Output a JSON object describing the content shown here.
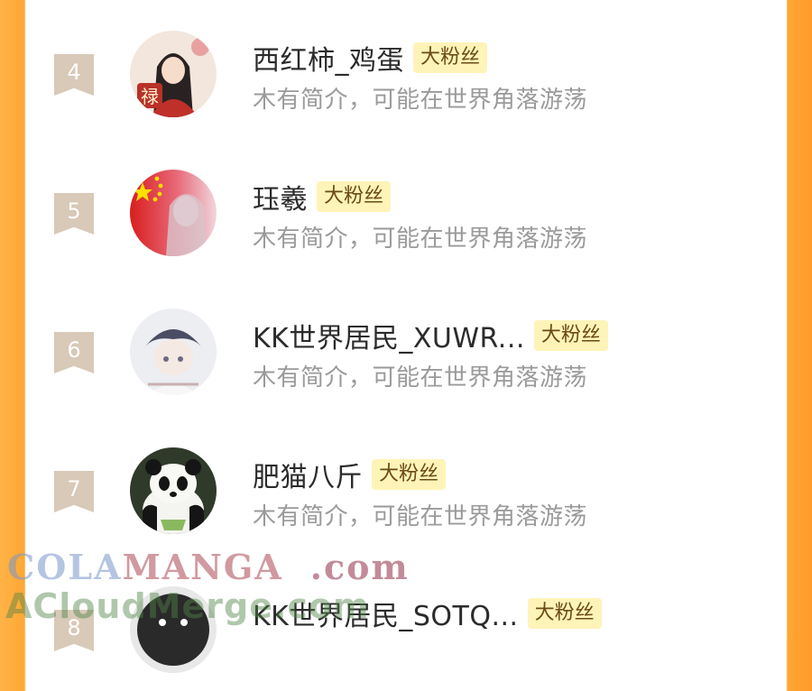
{
  "list": {
    "badge_text": "大粉丝",
    "rows": [
      {
        "rank": "4",
        "name": "西红柿_鸡蛋",
        "badge": "大粉丝",
        "desc": "木有简介，可能在世界角落游荡"
      },
      {
        "rank": "5",
        "name": "珏羲",
        "badge": "大粉丝",
        "desc": "木有简介，可能在世界角落游荡"
      },
      {
        "rank": "6",
        "name": "KK世界居民_XUWR...",
        "badge": "大粉丝",
        "desc": "木有简介，可能在世界角落游荡"
      },
      {
        "rank": "7",
        "name": "肥猫八斤",
        "badge": "大粉丝",
        "desc": "木有简介，可能在世界角落游荡"
      },
      {
        "rank": "8",
        "name": "KK世界居民_SOTQ...",
        "badge": "大粉丝",
        "desc": ""
      }
    ]
  },
  "watermark": {
    "line1_a": "COLA",
    "line1_b": "MANGA",
    "line1_c": ".com",
    "line2": "ACloudMerge.com"
  },
  "colors": {
    "side_orange": "#ffa733",
    "badge_bg": "#fff4b8",
    "rank_bg": "#d8c9b8"
  }
}
